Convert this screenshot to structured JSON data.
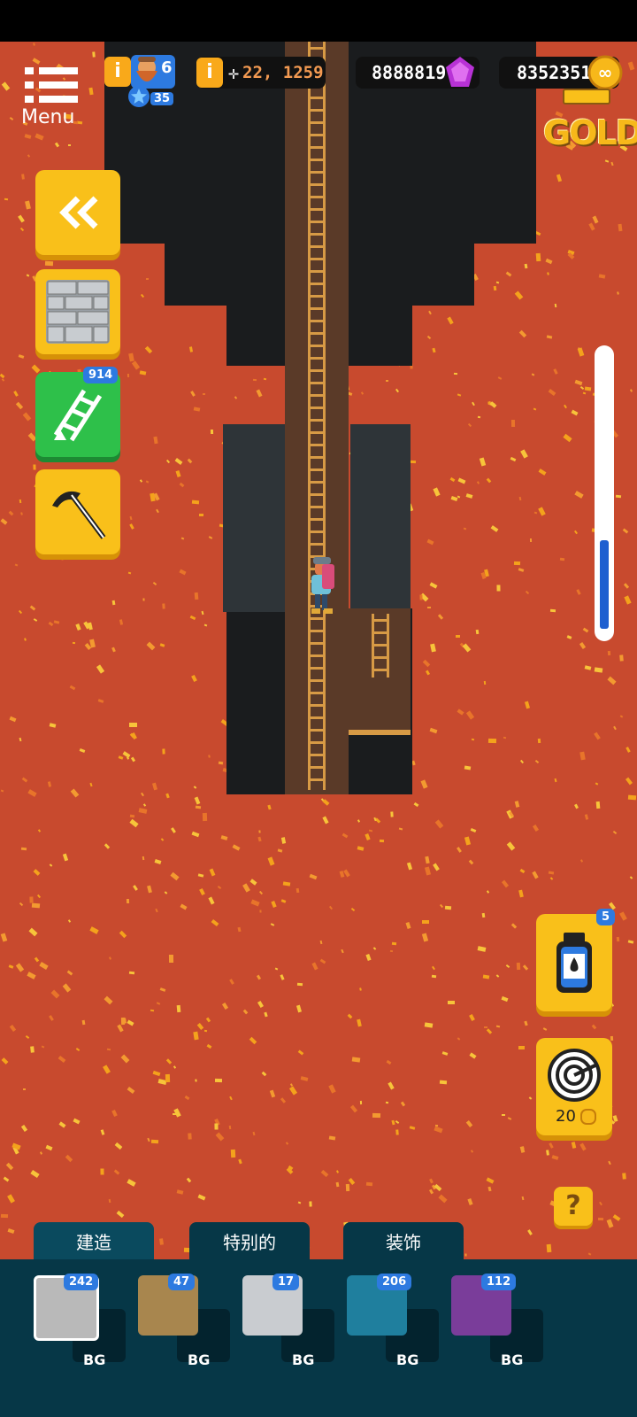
{
  "hud": {
    "menu_label": "Menu",
    "char_level": "6",
    "star_level": "35",
    "position": "22, 1259",
    "gems": "8888819",
    "gold": "8352351",
    "gold_label": "GOLD"
  },
  "left_tools": {
    "ladder_count": "914"
  },
  "right_tools": {
    "potion_count": "5",
    "radar_cost": "20",
    "help": "?"
  },
  "tabs": [
    "建造",
    "特别的",
    "装饰"
  ],
  "inventory": [
    {
      "count": "242",
      "bg_label": "BG",
      "color": "#b9b9b9"
    },
    {
      "count": "47",
      "bg_label": "BG",
      "color": "#a8864e"
    },
    {
      "count": "17",
      "bg_label": "BG",
      "color": "#c9ccd0"
    },
    {
      "count": "206",
      "bg_label": "BG",
      "color": "#1f7f9e"
    },
    {
      "count": "112",
      "bg_label": "BG",
      "color": "#7a3d9a"
    }
  ],
  "colors": {
    "lava": "#c84a2e",
    "button_yellow": "#f9c01a",
    "button_green": "#2ec04a",
    "tray": "#063747",
    "badge": "#2d7ae0",
    "gem": "#b832d6"
  },
  "icons": [
    "menu-icon",
    "info-icon",
    "dwarf-avatar-icon",
    "star-icon",
    "crosshair-icon",
    "gem-icon",
    "gold-coin-icon",
    "double-chevron-left-icon",
    "stone-wall-icon",
    "ladder-icon",
    "pickaxe-icon",
    "potion-icon",
    "radar-icon",
    "help-icon"
  ]
}
